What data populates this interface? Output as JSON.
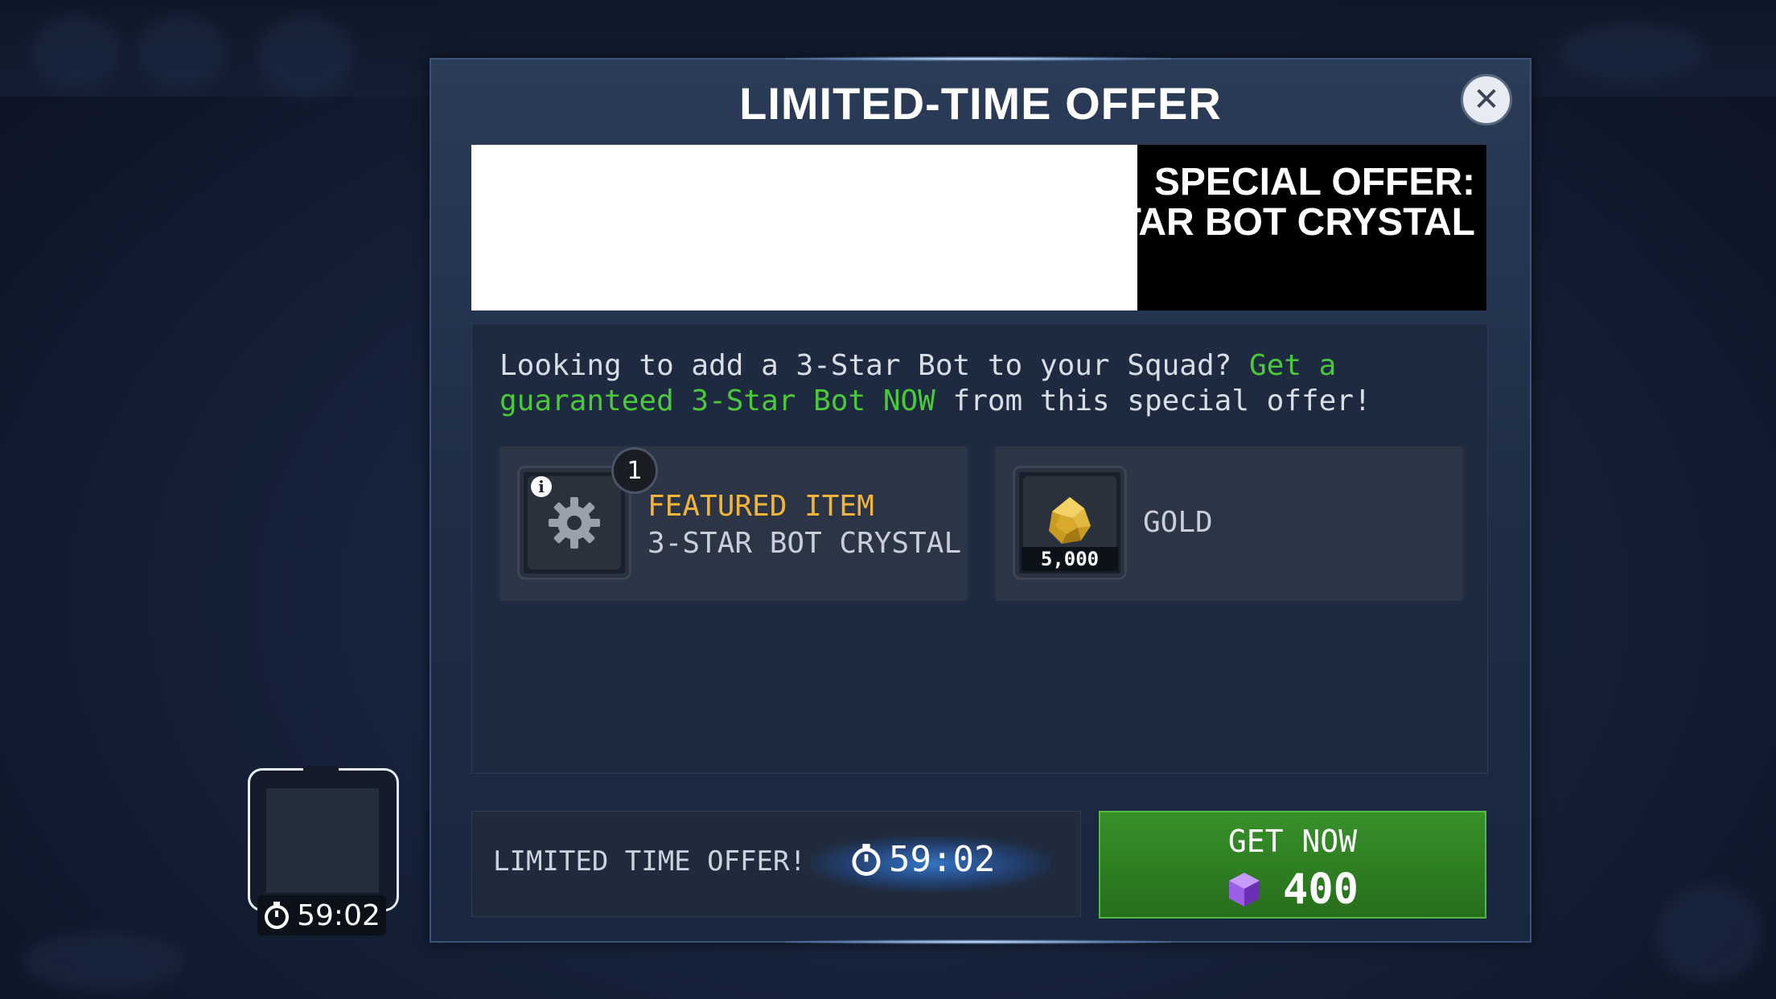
{
  "dialog": {
    "title": "LIMITED-TIME OFFER",
    "close_symbol": "✕"
  },
  "banner": {
    "line1": "SPECIAL OFFER:",
    "line2": "STAR BOT CRYSTAL"
  },
  "description": {
    "text_part1": "Looking to add a 3-Star Bot to your Squad? ",
    "highlight": "Get a guaranteed 3-Star Bot NOW",
    "text_part2": " from this special offer!"
  },
  "items": [
    {
      "featured_label": "FEATURED ITEM",
      "name": "3-STAR BOT CRYSTAL",
      "count": "1",
      "info": "i",
      "icon": "gear-icon"
    },
    {
      "name": "GOLD",
      "quantity": "5,000",
      "icon": "gold-nugget-icon"
    }
  ],
  "footer": {
    "offer_label": "LIMITED TIME OFFER!",
    "timer": "59:02",
    "button_label": "GET NOW",
    "price": "400",
    "currency_icon": "purple-gem-icon"
  },
  "side_widget": {
    "timer": "59:02"
  },
  "colors": {
    "highlight_green": "#4cc93a",
    "featured_gold": "#f2b53a",
    "button_green": "#2e7d22"
  }
}
